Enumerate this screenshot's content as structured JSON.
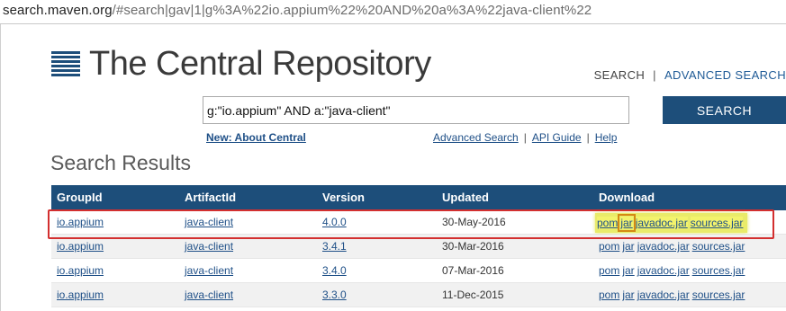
{
  "browser": {
    "url_host": "search.maven.org",
    "url_rest": "/#search|gav|1|g%3A%22io.appium%22%20AND%20a%3A%22java-client%22"
  },
  "header": {
    "title": "The Central Repository",
    "nav_search": "SEARCH",
    "nav_separator": "|",
    "nav_advanced": "ADVANCED SEARCH"
  },
  "search": {
    "query": "g:\"io.appium\" AND a:\"java-client\"",
    "button_label": "SEARCH"
  },
  "links": {
    "about": "New: About Central",
    "advanced": "Advanced Search",
    "api_guide": "API Guide",
    "help": "Help",
    "separator": "|"
  },
  "results": {
    "title": "Search Results",
    "columns": [
      "GroupId",
      "ArtifactId",
      "Version",
      "Updated",
      "Download"
    ],
    "rows": [
      {
        "group": "io.appium",
        "artifact": "java-client",
        "version": "4.0.0",
        "updated": "30-May-2016",
        "downloads": [
          "pom",
          "jar",
          "javadoc.jar",
          "sources.jar"
        ],
        "highlighted": true
      },
      {
        "group": "io.appium",
        "artifact": "java-client",
        "version": "3.4.1",
        "updated": "30-Mar-2016",
        "downloads": [
          "pom",
          "jar",
          "javadoc.jar",
          "sources.jar"
        ],
        "highlighted": false
      },
      {
        "group": "io.appium",
        "artifact": "java-client",
        "version": "3.4.0",
        "updated": "07-Mar-2016",
        "downloads": [
          "pom",
          "jar",
          "javadoc.jar",
          "sources.jar"
        ],
        "highlighted": false
      },
      {
        "group": "io.appium",
        "artifact": "java-client",
        "version": "3.3.0",
        "updated": "11-Dec-2015",
        "downloads": [
          "pom",
          "jar",
          "javadoc.jar",
          "sources.jar"
        ],
        "highlighted": false
      }
    ]
  },
  "colors": {
    "brand": "#1d4e7a",
    "link": "#1e4f87",
    "highlight": "#f3f36c",
    "annotation_red": "#d32f2f",
    "annotation_orange": "#d48a14"
  }
}
